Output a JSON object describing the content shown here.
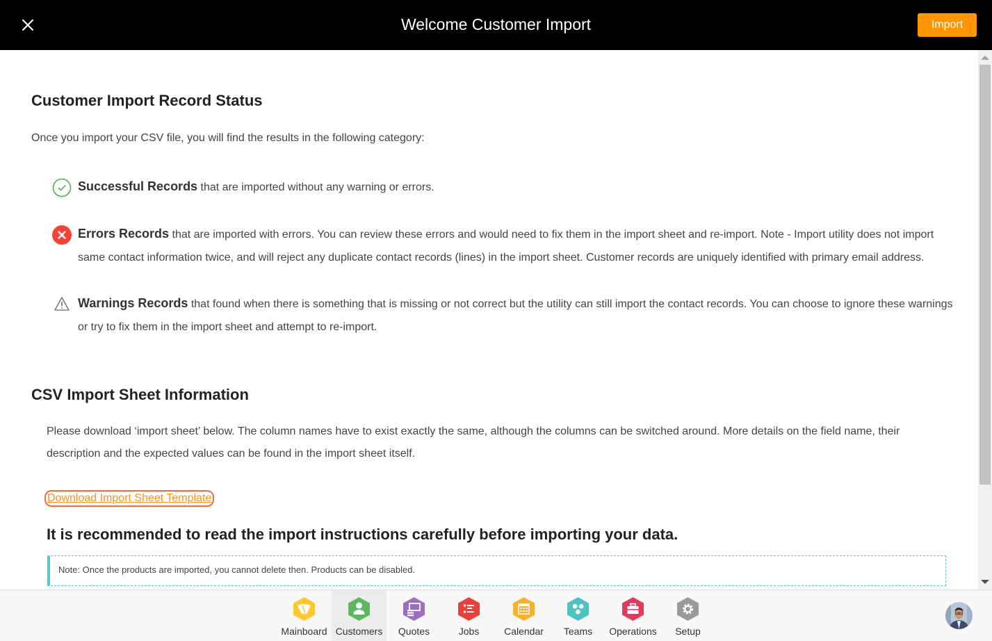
{
  "header": {
    "title": "Welcome Customer Import",
    "import_label": "Import",
    "close_icon": "close-icon"
  },
  "status_section": {
    "heading": "Customer Import Record Status",
    "intro": "Once you import your CSV file, you will find the results in the following category:",
    "items": [
      {
        "icon": "check-circle-icon",
        "title": "Successful Records",
        "text": " that are imported without any warning or errors."
      },
      {
        "icon": "error-circle-icon",
        "title": "Errors Records",
        "text": " that are imported with errors. You can review these errors and would need to fix them in the import sheet and re-import. Note - Import utility does not import same contact information twice, and will reject any duplicate contact records (lines) in the import sheet. Customer records are uniquely identified with primary email address."
      },
      {
        "icon": "warning-triangle-icon",
        "title": "Warnings Records",
        "text": " that found when there is something that is missing or not correct but the utility can still import the contact records. You can choose to ignore these warnings or try to fix them in the import sheet and attempt to re-import."
      }
    ]
  },
  "csv_section": {
    "heading": "CSV Import Sheet Information",
    "description": "Please download ‘import sheet’ below. The column names have to exist exactly the same, although the columns can be switched around. More details on the field name, their description and the expected values can be found in the import sheet itself.",
    "download_link": "Download Import Sheet Template",
    "recommendation": "It is recommended to read the import instructions carefully before importing your data.",
    "note": "Note: Once the products are imported, you cannot delete then. Products can be disabled."
  },
  "bottom_nav": {
    "items": [
      {
        "label": "Mainboard",
        "icon": "mainboard-icon",
        "color": "#fdc830",
        "active": false
      },
      {
        "label": "Customers",
        "icon": "customer-icon",
        "color": "#5cb85c",
        "active": true
      },
      {
        "label": "Quotes",
        "icon": "quotes-icon",
        "color": "#9b6fc0",
        "active": false
      },
      {
        "label": "Jobs",
        "icon": "jobs-icon",
        "color": "#e8413b",
        "active": false
      },
      {
        "label": "Calendar",
        "icon": "calendar-icon",
        "color": "#f7b12a",
        "active": false
      },
      {
        "label": "Teams",
        "icon": "teams-icon",
        "color": "#4fc1bf",
        "active": false
      },
      {
        "label": "Operations",
        "icon": "operations-icon",
        "color": "#e5395b",
        "active": false
      },
      {
        "label": "Setup",
        "icon": "setup-icon",
        "color": "#9a9a9a",
        "active": false
      }
    ]
  },
  "colors": {
    "accent": "#ff9600",
    "success": "#4caf50",
    "error": "#f44336",
    "note_border": "#5bc4c4",
    "link": "#f7931e"
  }
}
